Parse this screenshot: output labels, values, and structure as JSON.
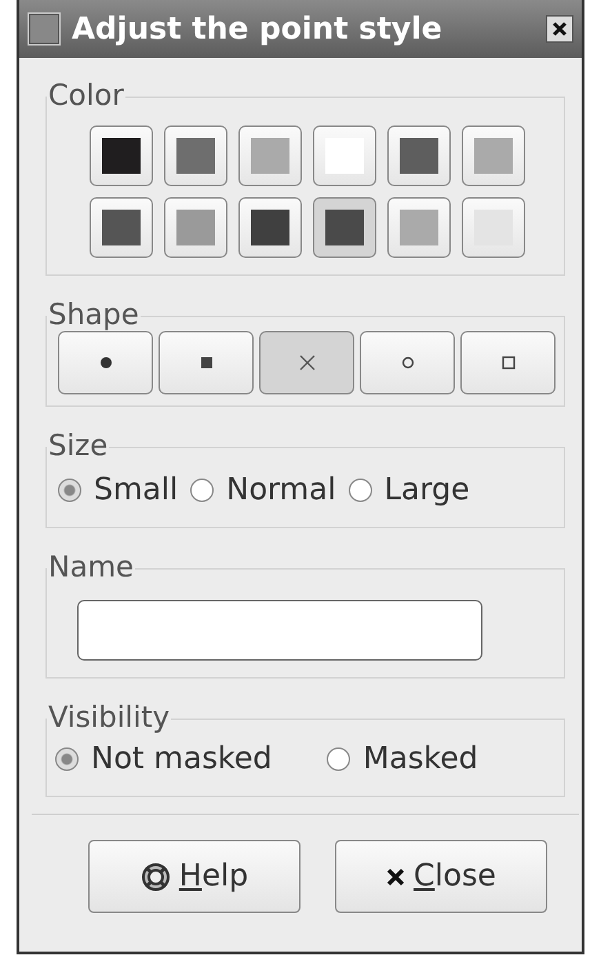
{
  "window": {
    "title": "Adjust the point style"
  },
  "color": {
    "label": "Color",
    "swatches": [
      {
        "color": "#201e1f",
        "selected": false
      },
      {
        "color": "#6e6e6e",
        "selected": false
      },
      {
        "color": "#aaaaaa",
        "selected": false
      },
      {
        "color": "#ffffff",
        "selected": false
      },
      {
        "color": "#5e5e5e",
        "selected": false
      },
      {
        "color": "#aaaaaa",
        "selected": false
      },
      {
        "color": "#555555",
        "selected": false
      },
      {
        "color": "#9a9a9a",
        "selected": false
      },
      {
        "color": "#404040",
        "selected": false
      },
      {
        "color": "#4a4a4a",
        "selected": true
      },
      {
        "color": "#aaaaaa",
        "selected": false
      },
      {
        "color": "#e4e4e4",
        "selected": false
      }
    ]
  },
  "shape": {
    "label": "Shape",
    "options": [
      {
        "kind": "dot",
        "selected": false
      },
      {
        "kind": "square",
        "selected": false
      },
      {
        "kind": "cross",
        "selected": true
      },
      {
        "kind": "circle",
        "selected": false
      },
      {
        "kind": "box",
        "selected": false
      }
    ]
  },
  "size": {
    "label": "Size",
    "options": [
      {
        "label": "Small",
        "selected": true
      },
      {
        "label": "Normal",
        "selected": false
      },
      {
        "label": "Large",
        "selected": false
      }
    ]
  },
  "name": {
    "label": "Name"
  },
  "visibility": {
    "label": "Visibility",
    "options": [
      {
        "label": "Not masked",
        "selected": true
      },
      {
        "label": "Masked",
        "selected": false
      }
    ]
  },
  "buttons": [
    {
      "kind": "help",
      "label": "Help",
      "mnemonic_first": true
    },
    {
      "kind": "close",
      "label": "Close",
      "mnemonic_first": true
    }
  ]
}
